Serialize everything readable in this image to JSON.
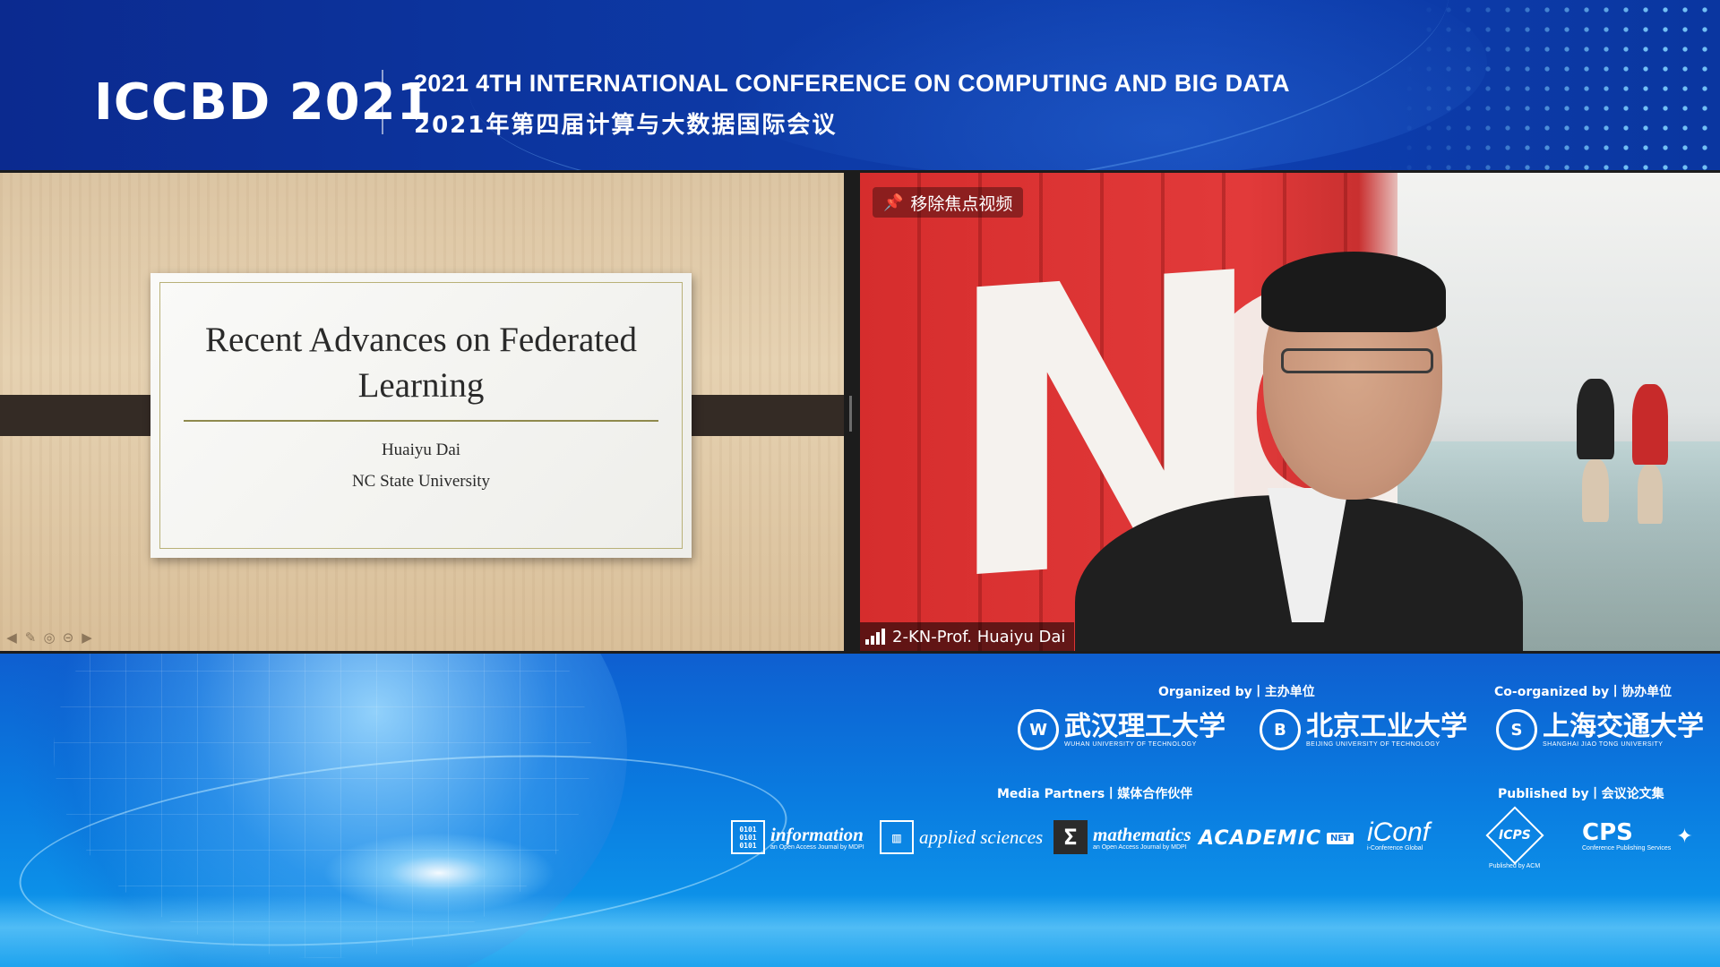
{
  "header": {
    "brand": "ICCBD 2021",
    "conference_en": "2021 4TH INTERNATIONAL CONFERENCE ON COMPUTING AND BIG DATA",
    "conference_cn": "2021年第四届计算与大数据国际会议"
  },
  "slide": {
    "title_line1": "Recent Advances on Federated",
    "title_line2": "Learning",
    "author": "Huaiyu Dai",
    "affiliation": "NC State University",
    "controls": [
      "prev-arrow-icon",
      "pen-icon",
      "settings-icon",
      "more-icon",
      "next-arrow-icon"
    ]
  },
  "video": {
    "pin_label": "移除焦点视频",
    "participant_name": "2-KN-Prof. Huaiyu Dai",
    "icons": [
      "pin-icon",
      "signal-strength-icon"
    ]
  },
  "footer": {
    "organized_label": "Organized by丨主办单位",
    "coorganized_label": "Co-organized by丨协办单位",
    "media_label": "Media Partners丨媒体合作伙伴",
    "published_label": "Published by丨会议论文集",
    "organizers": [
      {
        "name_cn": "武汉理工大学",
        "name_en": "WUHAN UNIVERSITY OF TECHNOLOGY"
      },
      {
        "name_cn": "北京工业大学",
        "name_en": "BEIJING UNIVERSITY OF TECHNOLOGY"
      }
    ],
    "coorganizer": {
      "name_cn": "上海交通大学",
      "name_en": "SHANGHAI JIAO TONG UNIVERSITY"
    },
    "media": [
      {
        "title": "information",
        "sub": "an Open Access Journal by MDPI"
      },
      {
        "title": "applied sciences",
        "sub": ""
      },
      {
        "title": "mathematics",
        "sub": "an Open Access Journal by MDPI"
      },
      {
        "title": "ACADEMIC",
        "badge": "NET"
      },
      {
        "title": "iConf",
        "sub": "i-Conference Global"
      }
    ],
    "publishers": [
      {
        "title": "ICPS",
        "sub": "Published by ACM"
      },
      {
        "title": "CPS",
        "sub": "Conference Publishing Services"
      }
    ]
  },
  "colors": {
    "header_blue": "#0b2a8f",
    "wall_red": "#e23a3a",
    "footer_blue": "#0a7be0",
    "text_white": "#ffffff"
  }
}
